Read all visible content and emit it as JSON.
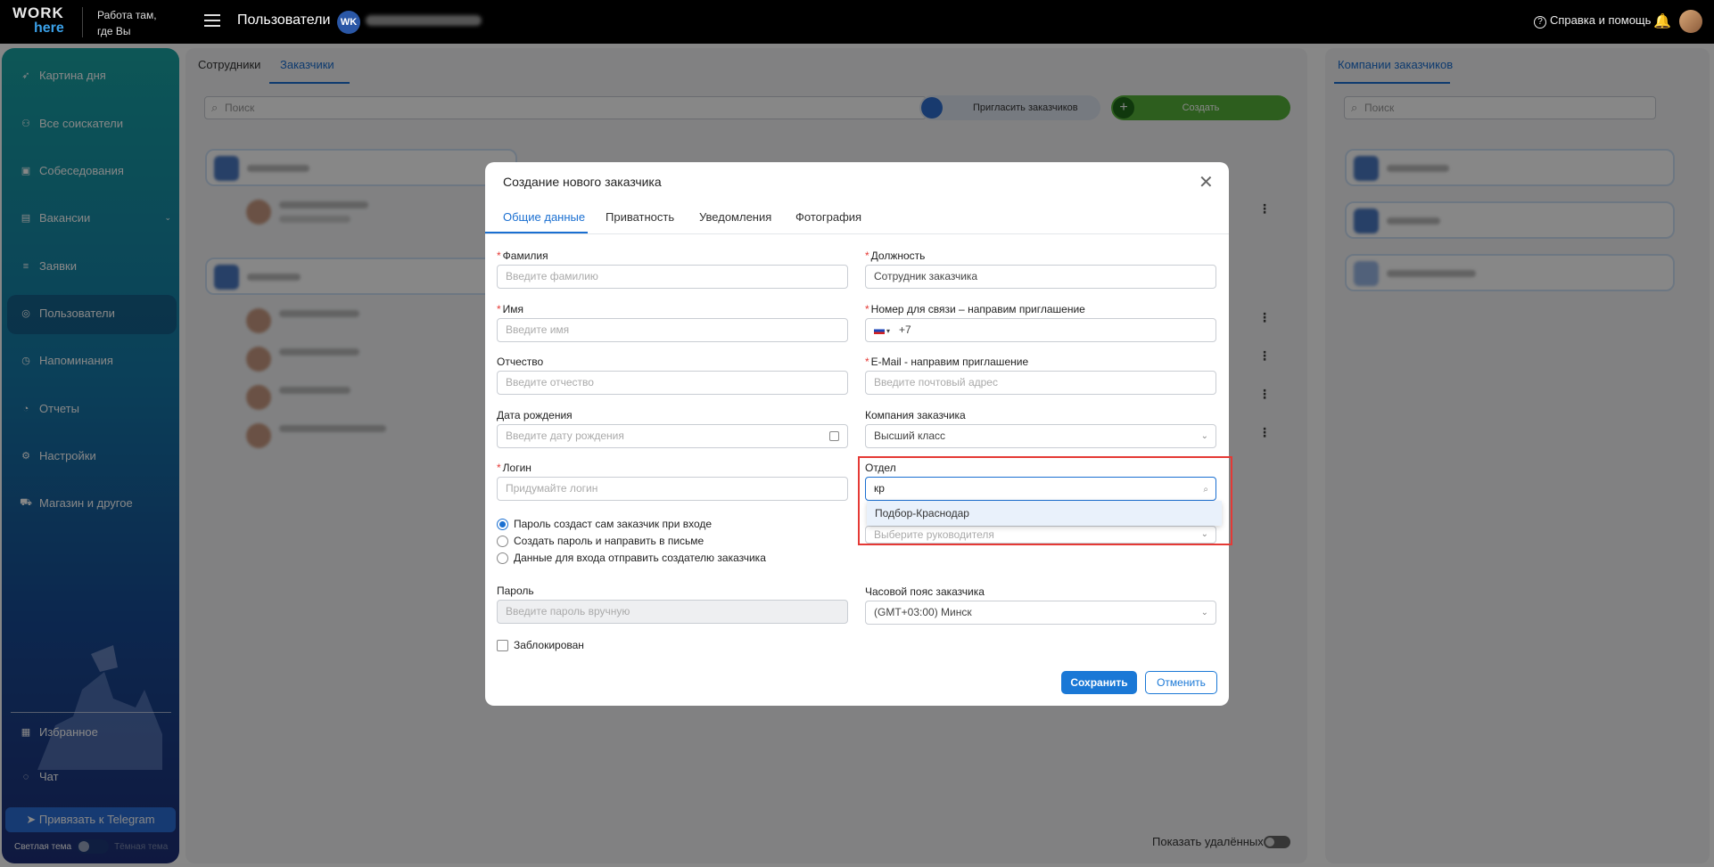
{
  "topbar": {
    "logo_top": "WORK",
    "logo_bottom": "here",
    "tagline": "Работа там, где Вы",
    "page_title": "Пользователи",
    "badge": "WK",
    "help": "Справка и помощь"
  },
  "sidebar": {
    "items": [
      {
        "label": "Картина дня",
        "icon": "rocket-icon"
      },
      {
        "label": "Все соискатели",
        "icon": "people-icon"
      },
      {
        "label": "Собеседования",
        "icon": "calendar-icon"
      },
      {
        "label": "Вакансии",
        "icon": "vacancy-icon"
      },
      {
        "label": "Заявки",
        "icon": "list-icon"
      },
      {
        "label": "Пользователи",
        "icon": "user-icon"
      },
      {
        "label": "Напоминания",
        "icon": "clock-icon"
      },
      {
        "label": "Отчеты",
        "icon": "report-icon"
      },
      {
        "label": "Настройки",
        "icon": "gear-icon"
      },
      {
        "label": "Магазин и другое",
        "icon": "cart-icon"
      }
    ],
    "favorites": "Избранное",
    "chat": "Чат",
    "telegram": "Привязать к Telegram",
    "light_theme": "Светлая тема",
    "dark_theme": "Тёмная тема"
  },
  "main": {
    "tabs": [
      "Сотрудники",
      "Заказчики"
    ],
    "search_placeholder": "Поиск",
    "invite_button": "Пригласить заказчиков",
    "create_button": "Создать",
    "show_deleted": "Показать удалённых"
  },
  "right": {
    "tab": "Компании заказчиков",
    "search_placeholder": "Поиск"
  },
  "modal": {
    "title": "Создание нового заказчика",
    "tabs": [
      "Общие данные",
      "Приватность",
      "Уведомления",
      "Фотография"
    ],
    "fields": {
      "last_name": {
        "label": "Фамилия",
        "placeholder": "Введите фамилию"
      },
      "position": {
        "label": "Должность",
        "value": "Сотрудник заказчика"
      },
      "first_name": {
        "label": "Имя",
        "placeholder": "Введите имя"
      },
      "phone": {
        "label": "Номер для связи – направим приглашение",
        "value": "+7"
      },
      "middle_name": {
        "label": "Отчество",
        "placeholder": "Введите отчество"
      },
      "email": {
        "label": "E-Mail - направим приглашение",
        "placeholder": "Введите почтовый адрес"
      },
      "birth_date": {
        "label": "Дата рождения",
        "placeholder": "Введите дату рождения"
      },
      "company": {
        "label": "Компания заказчика",
        "value": "Высший класс"
      },
      "login": {
        "label": "Логин",
        "placeholder": "Придумайте логин"
      },
      "department": {
        "label": "Отдел",
        "value": "кр",
        "option": "Подбор-Краснодар"
      },
      "manager": {
        "placeholder": "Выберите руководителя"
      },
      "password": {
        "label": "Пароль",
        "placeholder": "Введите пароль вручную"
      },
      "timezone": {
        "label": "Часовой пояс заказчика",
        "value": "(GMT+03:00) Минск"
      }
    },
    "radios": [
      "Пароль создаст сам заказчик при входе",
      "Создать пароль и направить в письме",
      "Данные для входа отправить создателю заказчика"
    ],
    "blocked": "Заблокирован",
    "save": "Сохранить",
    "cancel": "Отменить"
  }
}
